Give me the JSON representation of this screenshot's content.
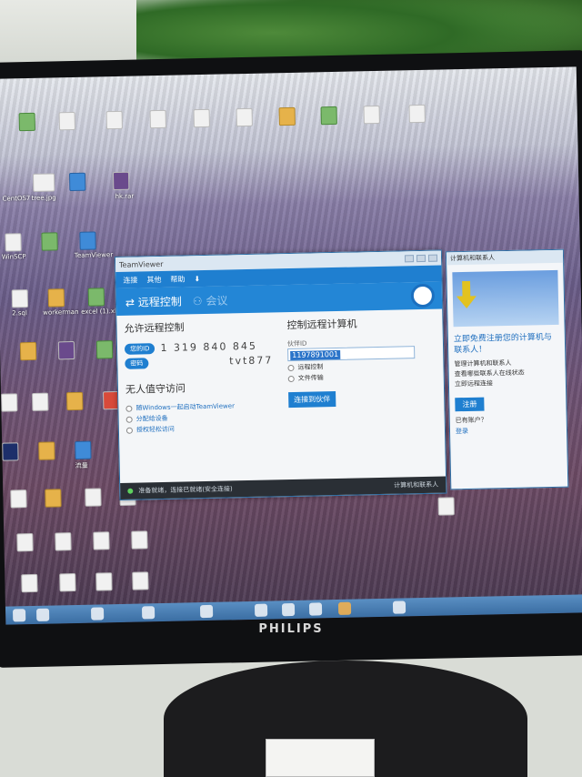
{
  "monitor_brand": "PHILIPS",
  "desktop_icons": [
    {
      "label": "CentOS7"
    },
    {
      "label": "tree.jpg"
    },
    {
      "label": "WinSCP"
    },
    {
      "label": "TeamViewer"
    },
    {
      "label": "2.sql"
    },
    {
      "label": "workerman"
    },
    {
      "label": "excel (1).xlsx"
    },
    {
      "label": "hk.rar"
    },
    {
      "label": "流量"
    }
  ],
  "teamviewer": {
    "title": "TeamViewer",
    "menu": [
      "连接",
      "其他",
      "帮助"
    ],
    "tabs": {
      "remote": "远程控制",
      "meeting": "会议"
    },
    "allow": {
      "heading": "允许远程控制",
      "id_label": "您的ID",
      "id_value": "1 319 840 845",
      "pw_label": "密码",
      "pw_value": "tvt877"
    },
    "unattended": {
      "heading": "无人值守访问",
      "options": [
        "随Windows一起启动TeamViewer",
        "分配给设备",
        "授权轻松访问"
      ]
    },
    "control": {
      "heading": "控制远程计算机",
      "partner_label": "伙伴ID",
      "partner_value": "1197891001",
      "opt_remote": "远程控制",
      "opt_file": "文件传输",
      "connect_label": "连接到伙伴"
    },
    "status": {
      "text": "准备就绪，连接已就绪(安全连接)",
      "right": "计算机和联系人"
    }
  },
  "contacts": {
    "title": "计算机和联系人",
    "link": "立即免费注册您的计算机与联系人！",
    "list": [
      "管理计算机和联系人",
      "查看哪些联系人在线状态",
      "立即远程连接"
    ],
    "register_label": "注册",
    "small": "已有账户？",
    "login": "登录"
  }
}
